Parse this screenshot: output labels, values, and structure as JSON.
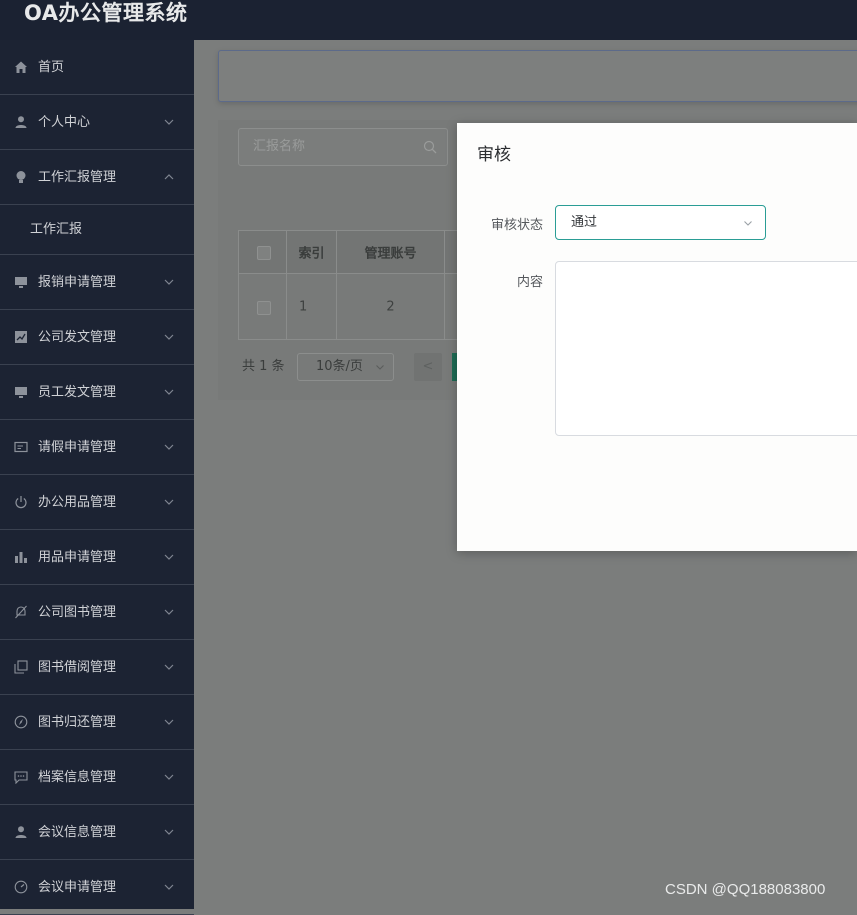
{
  "app": {
    "title": "OA办公管理系统"
  },
  "sidebar": {
    "items": [
      {
        "label": "首页",
        "icon": "home-icon"
      },
      {
        "label": "个人中心",
        "icon": "user-icon"
      },
      {
        "label": "工作汇报管理",
        "icon": "bulb-icon"
      },
      {
        "label": "工作汇报",
        "icon": ""
      },
      {
        "label": "报销申请管理",
        "icon": "monitor-icon"
      },
      {
        "label": "公司发文管理",
        "icon": "chart-line-icon"
      },
      {
        "label": "员工发文管理",
        "icon": "monitor-icon"
      },
      {
        "label": "请假申请管理",
        "icon": "card-icon"
      },
      {
        "label": "办公用品管理",
        "icon": "power-icon"
      },
      {
        "label": "用品申请管理",
        "icon": "bar-chart-icon"
      },
      {
        "label": "公司图书管理",
        "icon": "bell-off-icon"
      },
      {
        "label": "图书借阅管理",
        "icon": "copy-icon"
      },
      {
        "label": "图书归还管理",
        "icon": "compass-icon"
      },
      {
        "label": "档案信息管理",
        "icon": "chat-icon"
      },
      {
        "label": "会议信息管理",
        "icon": "user-icon"
      },
      {
        "label": "会议申请管理",
        "icon": "gauge-icon"
      }
    ]
  },
  "main": {
    "search_placeholder": "汇报名称",
    "table": {
      "headers": [
        "",
        "索引",
        "管理账号"
      ],
      "rows": [
        {
          "index": "1",
          "account": "2"
        }
      ]
    },
    "pager": {
      "total": "共 1 条",
      "page_size": "10条/页",
      "prev": "<"
    }
  },
  "modal": {
    "title": "审核",
    "status_label": "审核状态",
    "status_value": "通过",
    "content_label": "内容",
    "content_value": ""
  },
  "watermark": "CSDN @QQ188083800",
  "colors": {
    "sidebar_bg": "#1c2333",
    "accent": "#2a9d95",
    "overlay": "#7b7d7c"
  }
}
